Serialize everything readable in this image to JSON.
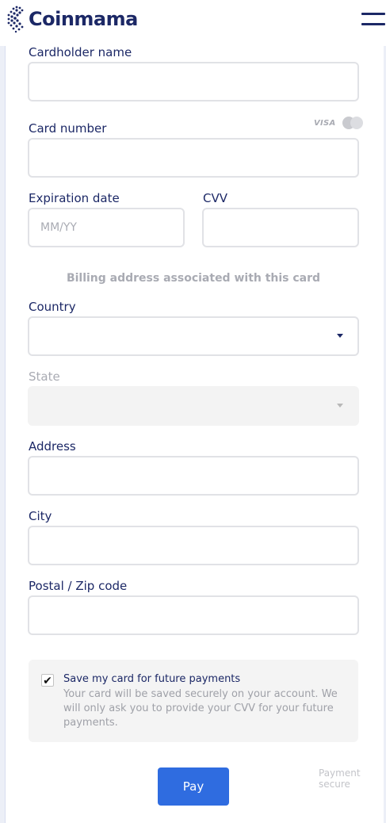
{
  "header": {
    "brand": "Coinmama",
    "logo_icon": "coinmama-dots-logo",
    "menu_icon": "hamburger-menu-icon"
  },
  "form": {
    "cardholder_name": {
      "label": "Cardholder name",
      "value": ""
    },
    "card_number": {
      "label": "Card number",
      "value": "",
      "brands": [
        "VISA",
        "mastercard-icon"
      ]
    },
    "expiration_date": {
      "label": "Expiration date",
      "placeholder": "MM/YY",
      "value": ""
    },
    "cvv": {
      "label": "CVV",
      "value": ""
    },
    "billing_title": "Billing address associated with this card",
    "country": {
      "label": "Country",
      "value": ""
    },
    "state": {
      "label": "State",
      "value": "",
      "disabled": true
    },
    "address": {
      "label": "Address",
      "value": ""
    },
    "city": {
      "label": "City",
      "value": ""
    },
    "postal": {
      "label": "Postal / Zip code",
      "value": ""
    }
  },
  "save_card": {
    "checked": true,
    "check_mark": "✔",
    "title": "Save my card for future payments",
    "description": "Your card will be saved securely on your account. We will only ask you to provide your CVV for your future payments."
  },
  "footer": {
    "pay_label": "Pay",
    "secure_text": "Payment secure"
  },
  "colors": {
    "brand_navy": "#1c2866",
    "pay_blue": "#2f6ce0",
    "border_grey": "#e1e2e6"
  }
}
